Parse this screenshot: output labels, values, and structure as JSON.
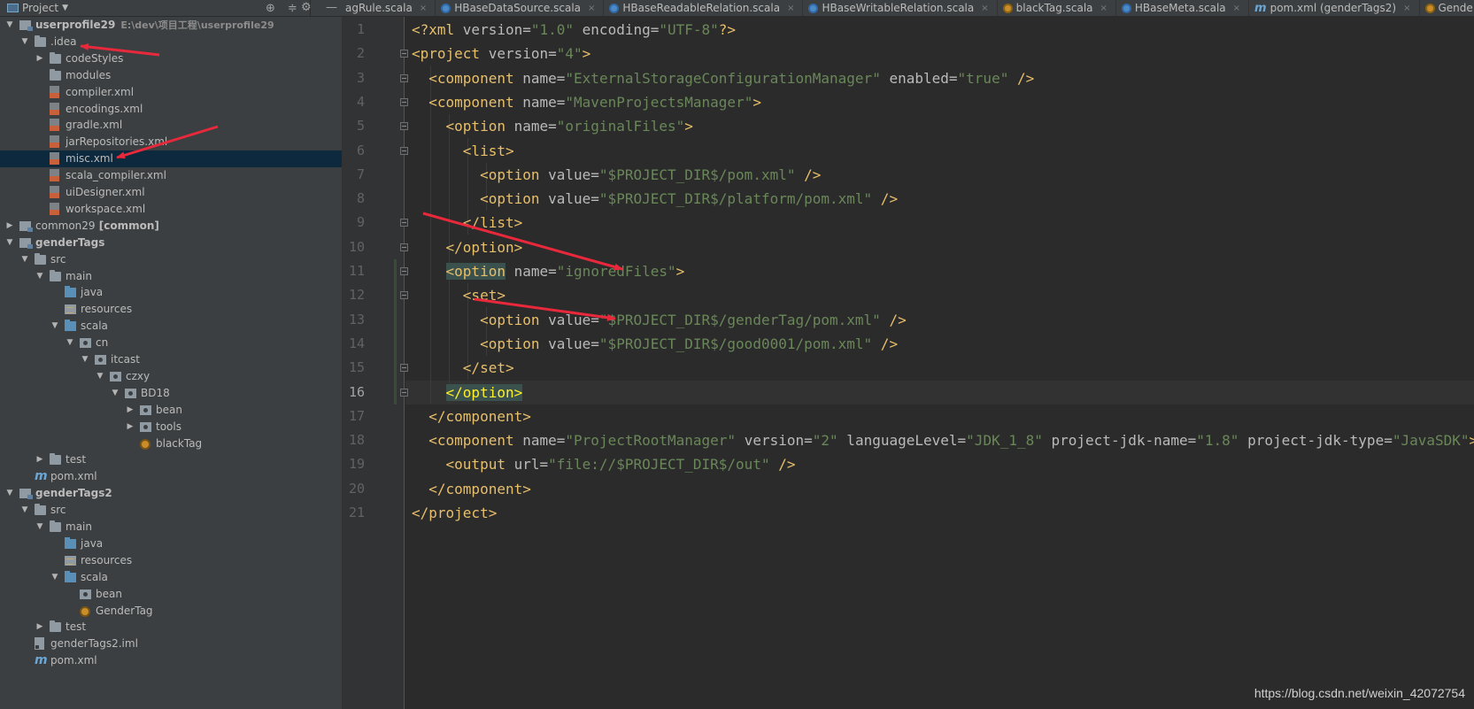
{
  "topbar": {
    "project_label": "Project",
    "tabs": [
      {
        "label": "agRule.scala",
        "icon": "scala-object-icon"
      },
      {
        "label": "HBaseDataSource.scala",
        "icon": "scala-class-icon"
      },
      {
        "label": "HBaseReadableRelation.scala",
        "icon": "scala-class-icon"
      },
      {
        "label": "HBaseWritableRelation.scala",
        "icon": "scala-class-icon"
      },
      {
        "label": "blackTag.scala",
        "icon": "scala-object-icon"
      },
      {
        "label": "HBaseMeta.scala",
        "icon": "scala-class-icon"
      },
      {
        "label": "pom.xml (genderTags2)",
        "icon": "maven-icon"
      },
      {
        "label": "Gende",
        "icon": "scala-object-icon"
      }
    ]
  },
  "tree": [
    {
      "label": "userprofile29",
      "path": "E:\\dev\\项目工程\\userprofile29"
    },
    {
      "label": ".idea"
    },
    {
      "label": "codeStyles"
    },
    {
      "label": "modules"
    },
    {
      "label": "compiler.xml"
    },
    {
      "label": "encodings.xml"
    },
    {
      "label": "gradle.xml"
    },
    {
      "label": "jarRepositories.xml"
    },
    {
      "label": "misc.xml"
    },
    {
      "label": "scala_compiler.xml"
    },
    {
      "label": "uiDesigner.xml"
    },
    {
      "label": "workspace.xml"
    },
    {
      "label": "common29",
      "suffix": "[common]"
    },
    {
      "label": "genderTags"
    },
    {
      "label": "src"
    },
    {
      "label": "main"
    },
    {
      "label": "java"
    },
    {
      "label": "resources"
    },
    {
      "label": "scala"
    },
    {
      "label": "cn"
    },
    {
      "label": "itcast"
    },
    {
      "label": "czxy"
    },
    {
      "label": "BD18"
    },
    {
      "label": "bean"
    },
    {
      "label": "tools"
    },
    {
      "label": "blackTag"
    },
    {
      "label": "test"
    },
    {
      "label": "pom.xml"
    },
    {
      "label": "genderTags2"
    },
    {
      "label": "src"
    },
    {
      "label": "main"
    },
    {
      "label": "java"
    },
    {
      "label": "resources"
    },
    {
      "label": "scala"
    },
    {
      "label": "bean"
    },
    {
      "label": "GenderTag"
    },
    {
      "label": "test"
    },
    {
      "label": "genderTags2.iml"
    },
    {
      "label": "pom.xml"
    }
  ],
  "editor": {
    "line_numbers": [
      "1",
      "2",
      "3",
      "4",
      "5",
      "6",
      "7",
      "8",
      "9",
      "10",
      "11",
      "12",
      "13",
      "14",
      "15",
      "16",
      "17",
      "18",
      "19",
      "20",
      "21"
    ],
    "current_line": "16",
    "lines": [
      [
        {
          "t": "<?xml ",
          "c": "t"
        },
        {
          "t": "version=",
          "c": "a"
        },
        {
          "t": "\"1.0\"",
          "c": "v"
        },
        {
          "t": " encoding=",
          "c": "a"
        },
        {
          "t": "\"UTF-8\"",
          "c": "v"
        },
        {
          "t": "?>",
          "c": "t"
        }
      ],
      [
        {
          "t": "<project ",
          "c": "t"
        },
        {
          "t": "version=",
          "c": "a"
        },
        {
          "t": "\"4\"",
          "c": "v"
        },
        {
          "t": ">",
          "c": "t"
        }
      ],
      [
        {
          "t": "  <component ",
          "c": "t"
        },
        {
          "t": "name=",
          "c": "a"
        },
        {
          "t": "\"ExternalStorageConfigurationManager\"",
          "c": "v"
        },
        {
          "t": " enabled=",
          "c": "a"
        },
        {
          "t": "\"true\"",
          "c": "v"
        },
        {
          "t": " />",
          "c": "t"
        }
      ],
      [
        {
          "t": "  <component ",
          "c": "t"
        },
        {
          "t": "name=",
          "c": "a"
        },
        {
          "t": "\"MavenProjectsManager\"",
          "c": "v"
        },
        {
          "t": ">",
          "c": "t"
        }
      ],
      [
        {
          "t": "    <option ",
          "c": "t"
        },
        {
          "t": "name=",
          "c": "a"
        },
        {
          "t": "\"originalFiles\"",
          "c": "v"
        },
        {
          "t": ">",
          "c": "t"
        }
      ],
      [
        {
          "t": "      <list>",
          "c": "t"
        }
      ],
      [
        {
          "t": "        <option ",
          "c": "t"
        },
        {
          "t": "value=",
          "c": "a"
        },
        {
          "t": "\"$PROJECT_DIR$/pom.xml\"",
          "c": "v"
        },
        {
          "t": " />",
          "c": "t"
        }
      ],
      [
        {
          "t": "        <option ",
          "c": "t"
        },
        {
          "t": "value=",
          "c": "a"
        },
        {
          "t": "\"$PROJECT_DIR$/platform/pom.xml\"",
          "c": "v"
        },
        {
          "t": " />",
          "c": "t"
        }
      ],
      [
        {
          "t": "      </list>",
          "c": "t"
        }
      ],
      [
        {
          "t": "    </option>",
          "c": "t"
        }
      ],
      [
        {
          "t": "    ",
          "c": "t"
        },
        {
          "t": "<option",
          "c": "t hl"
        },
        {
          "t": " ",
          "c": "t"
        },
        {
          "t": "name=",
          "c": "a"
        },
        {
          "t": "\"ignoredFiles\"",
          "c": "v"
        },
        {
          "t": ">",
          "c": "t"
        }
      ],
      [
        {
          "t": "      <set>",
          "c": "t"
        }
      ],
      [
        {
          "t": "        <option ",
          "c": "t"
        },
        {
          "t": "value=",
          "c": "a"
        },
        {
          "t": "\"$PROJECT_DIR$/genderTag/pom.xml\"",
          "c": "v"
        },
        {
          "t": " />",
          "c": "t"
        }
      ],
      [
        {
          "t": "        <option ",
          "c": "t"
        },
        {
          "t": "value=",
          "c": "a"
        },
        {
          "t": "\"$PROJECT_DIR$/good0001/pom.xml\"",
          "c": "v"
        },
        {
          "t": " />",
          "c": "t"
        }
      ],
      [
        {
          "t": "      </set>",
          "c": "t"
        }
      ],
      [
        {
          "t": "    ",
          "c": "t"
        },
        {
          "t": "</option>",
          "c": "hl2"
        }
      ],
      [
        {
          "t": "  </component>",
          "c": "t"
        }
      ],
      [
        {
          "t": "  <component ",
          "c": "t"
        },
        {
          "t": "name=",
          "c": "a"
        },
        {
          "t": "\"ProjectRootManager\"",
          "c": "v"
        },
        {
          "t": " version=",
          "c": "a"
        },
        {
          "t": "\"2\"",
          "c": "v"
        },
        {
          "t": " languageLevel=",
          "c": "a"
        },
        {
          "t": "\"JDK_1_8\"",
          "c": "v"
        },
        {
          "t": " project-jdk-name=",
          "c": "a"
        },
        {
          "t": "\"1.8\"",
          "c": "v"
        },
        {
          "t": " project-jdk-type=",
          "c": "a"
        },
        {
          "t": "\"JavaSDK\"",
          "c": "v"
        },
        {
          "t": ">",
          "c": "t"
        }
      ],
      [
        {
          "t": "    <output ",
          "c": "t"
        },
        {
          "t": "url=",
          "c": "a"
        },
        {
          "t": "\"file://$PROJECT_DIR$/out\"",
          "c": "v"
        },
        {
          "t": " />",
          "c": "t"
        }
      ],
      [
        {
          "t": "  </component>",
          "c": "t"
        }
      ],
      [
        {
          "t": "</project>",
          "c": "t"
        }
      ]
    ]
  },
  "colors": {
    "annotation_arrow": "#e8283b",
    "selection": "#0d293e",
    "xml_tag": "#e8bf6a",
    "xml_value": "#6a8759"
  },
  "watermark": "https://blog.csdn.net/weixin_42072754"
}
